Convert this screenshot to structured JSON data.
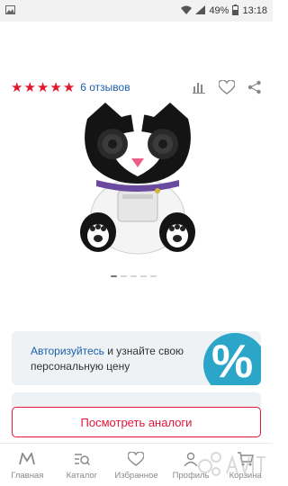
{
  "status_bar": {
    "battery_percent": "49%",
    "time": "13:18",
    "icons": [
      "image-notification-icon",
      "wifi-icon",
      "signal-icon",
      "battery-icon"
    ]
  },
  "rating": {
    "stars": 5,
    "reviews_label": "6 отзывов",
    "star_color": "#e2162f"
  },
  "actions": {
    "icons": [
      "chart-icon",
      "heart-icon",
      "share-icon"
    ]
  },
  "gallery": {
    "image_alt": "product-photo",
    "slides": 5,
    "active_index": 0
  },
  "promo": {
    "link_text": "Авторизуйтесь",
    "rest_text": " и узнайте свою персональную цену",
    "badge_text": "%",
    "badge_color": "#2ba6c8"
  },
  "cta": {
    "label": "Посмотреть аналоги",
    "color": "#e2163a"
  },
  "nav": {
    "items": [
      {
        "label": "Главная",
        "icon": "m-logo-icon"
      },
      {
        "label": "Каталог",
        "icon": "catalog-search-icon"
      },
      {
        "label": "Избранное",
        "icon": "heart-icon"
      },
      {
        "label": "Профиль",
        "icon": "person-icon"
      },
      {
        "label": "Корзина",
        "icon": "cart-icon"
      }
    ]
  },
  "accent_link_color": "#1b5fab"
}
